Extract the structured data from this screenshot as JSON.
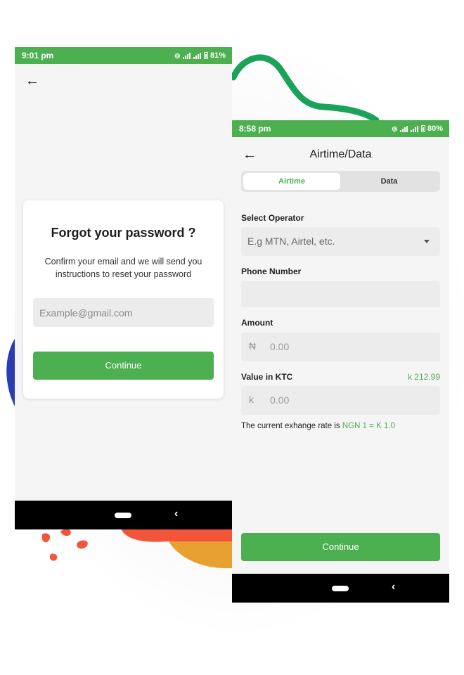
{
  "colors": {
    "accent": "#4caf50",
    "status_bar": "#4caf50",
    "nav_bar": "#000000",
    "screen_bg": "#f5f5f5"
  },
  "forgot_screen": {
    "status_bar": {
      "time": "9:01 pm",
      "battery": "81%"
    },
    "back_icon": "arrow-left-icon",
    "title": "Forgot your password ?",
    "description": "Confirm your email and we will send you instructions to reset your password",
    "email_field": {
      "value": "",
      "placeholder": "Example@gmail.com"
    },
    "continue_label": "Continue",
    "nav_back_glyph": "‹"
  },
  "airtime_screen": {
    "status_bar": {
      "time": "8:58 pm",
      "battery": "80%"
    },
    "title": "Airtime/Data",
    "tabs": [
      {
        "label": "Airtime",
        "active": true
      },
      {
        "label": "Data",
        "active": false
      }
    ],
    "operator": {
      "label": "Select Operator",
      "placeholder": "E.g MTN, Airtel, etc."
    },
    "phone": {
      "label": "Phone Number",
      "value": ""
    },
    "amount": {
      "label": "Amount",
      "prefix": "₦",
      "value": "0.00"
    },
    "ktc": {
      "label": "Value in KTC",
      "balance": "k 212.99",
      "prefix": "k",
      "value": "0.00"
    },
    "rate": {
      "text": "The current exhange rate is",
      "value": "NGN 1 = K 1.0"
    },
    "continue_label": "Continue",
    "nav_back_glyph": "‹"
  }
}
